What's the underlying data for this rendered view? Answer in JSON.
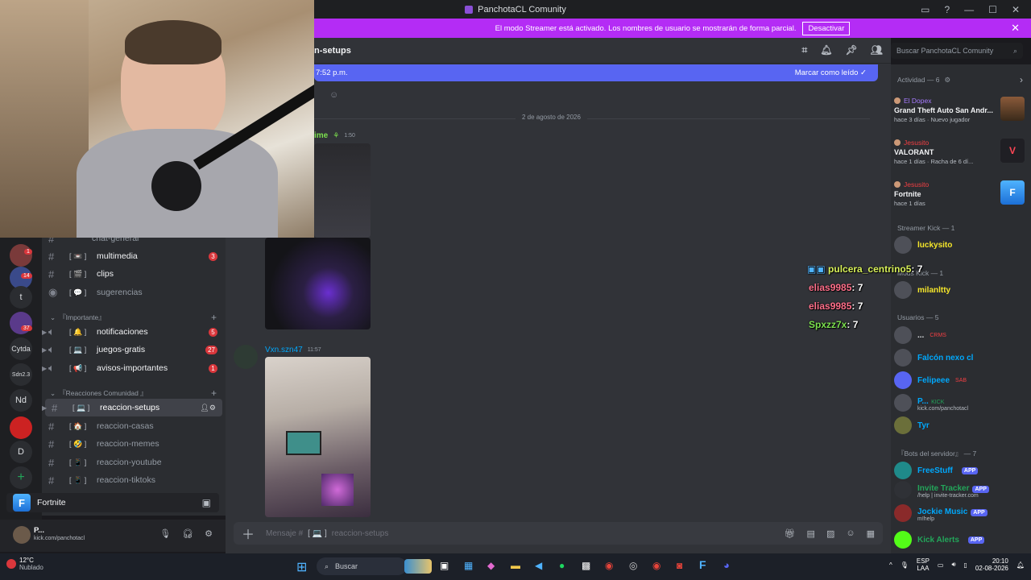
{
  "window": {
    "title": "PanchotaCL Comunity"
  },
  "streamer_banner": {
    "text": "El modo Streamer está activado. Los nombres de usuario se mostrarán de forma parcial.",
    "button": "Desactivar"
  },
  "channel_header": {
    "name": "n-setups"
  },
  "new_messages": {
    "left": "7:52 p.m.",
    "right": "Marcar como leído"
  },
  "date_divider": "2 de agosto de 2026",
  "messages": [
    {
      "author": "ime",
      "time": "1:50"
    },
    {
      "author": "Vxn.szn47",
      "time": "11:57"
    }
  ],
  "composer": {
    "prefix": "Mensaje #",
    "channel": "reaccion-setups"
  },
  "search": {
    "placeholder": "Buscar PanchotaCL Comunity"
  },
  "rail": {
    "badge_1": "1",
    "badge_2": "14",
    "badge_3": "37",
    "items": [
      "t",
      "Cytda",
      "Sdn2.3",
      "Nd",
      "D"
    ]
  },
  "channels": {
    "top_partial": "chat-general",
    "items": [
      {
        "name": "multimedia",
        "emoji": "[ 📼 ]",
        "badge": "3"
      },
      {
        "name": "clips",
        "emoji": "[ 🎬 ]",
        "badge": ""
      },
      {
        "name": "sugerencias",
        "emoji": "[ 💬 ]",
        "badge": ""
      },
      {
        "name": "notificaciones",
        "emoji": "[ 🔔 ]",
        "badge": "5"
      },
      {
        "name": "juegos-gratis",
        "emoji": "[ 💻 ]",
        "badge": "27"
      },
      {
        "name": "avisos-importantes",
        "emoji": "[ 📢 ]",
        "badge": "1"
      },
      {
        "name": "reaccion-setups",
        "emoji": "[ 💻 ]",
        "badge": ""
      },
      {
        "name": "reaccion-casas",
        "emoji": "[ 🏠 ]",
        "badge": ""
      },
      {
        "name": "reaccion-memes",
        "emoji": "[ 🤣 ]",
        "badge": ""
      },
      {
        "name": "reaccion-youtube",
        "emoji": "[ 📱 ]",
        "badge": ""
      },
      {
        "name": "reaccion-tiktoks",
        "emoji": "[ 📱 ]",
        "badge": ""
      }
    ],
    "cat_importante": "『Importante』",
    "cat_reacciones": "『Reacciones Comunidad 』"
  },
  "activity_bar": {
    "game": "Fortnite"
  },
  "userbar": {
    "name": "P...",
    "status": "kick.com/panchotacl"
  },
  "members": {
    "activity_title": "Actividad — 6",
    "activities": [
      {
        "user": "El Dopex",
        "game": "Grand Theft Auto San Andr...",
        "meta": "hace 3 días · Nuevo jugador"
      },
      {
        "user": "Jesusito",
        "game": "VALORANT",
        "meta": "hace 1 días · Racha de 6 dí..."
      },
      {
        "user": "Jesusito",
        "game": "Fortnite",
        "meta": "hace 1 días"
      }
    ],
    "groups": [
      {
        "label": "Streamer Kick — 1"
      },
      {
        "label": "Mods Kick — 1"
      },
      {
        "label": "Usuarios — 5"
      },
      {
        "label": "『Bots del servidor』 — 7"
      }
    ],
    "list": [
      {
        "name": "luckysito",
        "color": "#f5e62a",
        "sub": ""
      },
      {
        "name": "milanltty",
        "color": "#f5e62a",
        "sub": ""
      },
      {
        "name": "...",
        "color": "#dbdee1",
        "sub": "CRMS"
      },
      {
        "name": "Falcón nexo cl",
        "color": "#00a8fc",
        "sub": ""
      },
      {
        "name": "Felipeee",
        "color": "#00a8fc",
        "sub": "SAB"
      },
      {
        "name": "P...",
        "color": "#00a8fc",
        "sub": "kick.com/panchotacl"
      },
      {
        "name": "Tyr",
        "color": "#00a8fc",
        "sub": ""
      },
      {
        "name": "FreeStuff",
        "color": "#00a8fc",
        "sub": "",
        "tag": "APP"
      },
      {
        "name": "Invite Tracker",
        "color": "#23a55a",
        "sub": "/help | invite-tracker.com",
        "tag": "APP"
      },
      {
        "name": "Jockie Music",
        "color": "#00a8fc",
        "sub": "m!help",
        "tag": "APP"
      },
      {
        "name": "Kick Alerts",
        "color": "#23a55a",
        "sub": "",
        "tag": "APP"
      }
    ],
    "kick_tag": "KICK"
  },
  "overlay_chat": [
    {
      "user": "pulcera_centrino5",
      "count": ": 7",
      "color": "#d9f25a"
    },
    {
      "user": "elias9985",
      "count": ": 7",
      "color": "#ff6f8a"
    },
    {
      "user": "elias9985",
      "count": ": 7",
      "color": "#ff6f8a"
    },
    {
      "user": "Spxzz7x",
      "count": ": 7",
      "color": "#7be04e"
    }
  ],
  "taskbar": {
    "weather_temp": "12°C",
    "weather_desc": "Nublado",
    "search": "Buscar",
    "lang": "ESP",
    "lang2": "LAA",
    "time": "20:10",
    "date": "02-08-2026"
  }
}
